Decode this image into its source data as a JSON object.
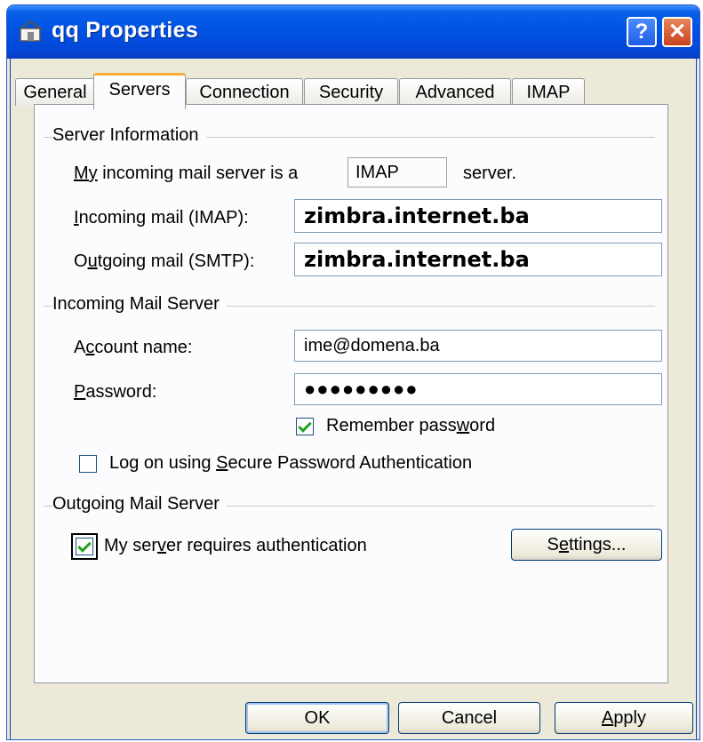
{
  "window": {
    "title": "qq Properties",
    "help_label": "?",
    "close_label": "✕"
  },
  "tabs": [
    {
      "label": "General",
      "active": false
    },
    {
      "label": "Servers",
      "active": true
    },
    {
      "label": "Connection",
      "active": false
    },
    {
      "label": "Security",
      "active": false
    },
    {
      "label": "Advanced",
      "active": false
    },
    {
      "label": "IMAP",
      "active": false
    }
  ],
  "server_info": {
    "group_label": "Server Information",
    "incoming_type_prefix_u": "My",
    "incoming_type_prefix_rest": " incoming mail server is a",
    "incoming_type_value": "IMAP",
    "incoming_type_suffix": "server.",
    "incoming_label_u": "I",
    "incoming_label_rest": "ncoming mail (IMAP):",
    "incoming_value": "zimbra.internet.ba",
    "outgoing_label_a": "O",
    "outgoing_label_u": "u",
    "outgoing_label_rest": "tgoing mail (SMTP):",
    "outgoing_value": "zimbra.internet.ba"
  },
  "incoming_server": {
    "group_label": "Incoming Mail Server",
    "account_label_a": "A",
    "account_label_u": "c",
    "account_label_rest": "count name:",
    "account_value": "ime@domena.ba",
    "password_label_u": "P",
    "password_label_rest": "assword:",
    "password_value": "●●●●●●●●●",
    "remember_a": "Remember pass",
    "remember_u": "w",
    "remember_rest": "ord",
    "remember_checked": true,
    "spa_a": "Log on using ",
    "spa_u": "S",
    "spa_rest": "ecure Password Authentication",
    "spa_checked": false
  },
  "outgoing_server": {
    "group_label": "Outgoing Mail Server",
    "auth_a": "My ser",
    "auth_u": "v",
    "auth_rest": "er requires authentication",
    "auth_checked": true,
    "settings_a": "S",
    "settings_u": "e",
    "settings_rest": "ttings..."
  },
  "buttons": {
    "ok": "OK",
    "cancel": "Cancel",
    "apply_u": "A",
    "apply_rest": "pply"
  }
}
